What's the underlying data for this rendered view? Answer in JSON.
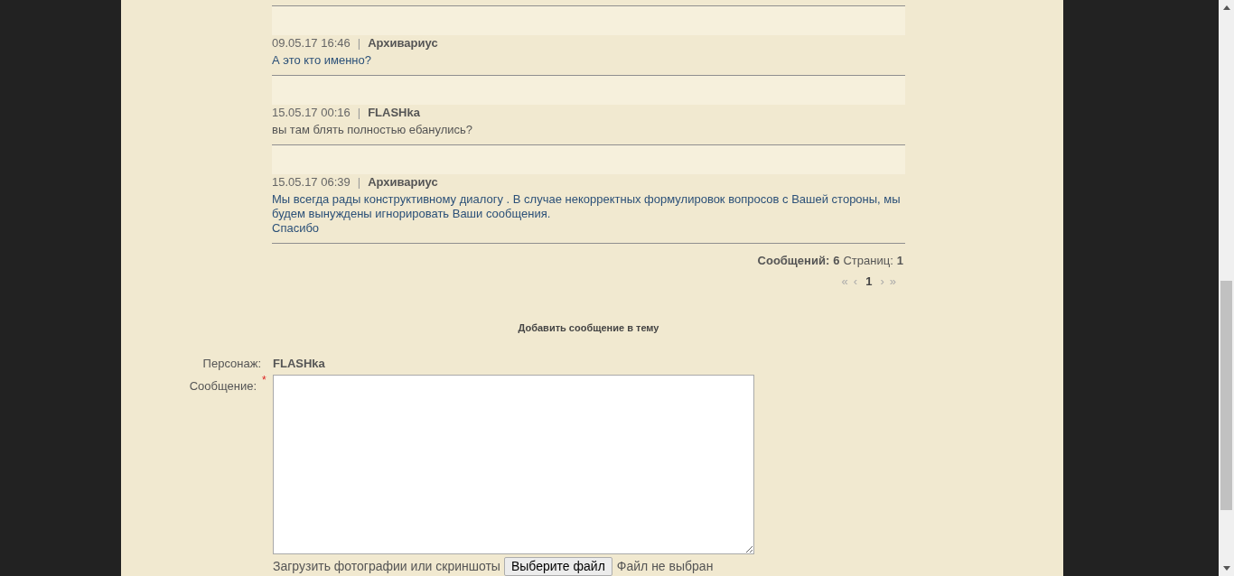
{
  "posts": [
    {
      "date": "09.05.17 16:46",
      "separator": "|",
      "author": "Архивариус",
      "kind": "staff",
      "body": [
        "А это кто именно?"
      ]
    },
    {
      "date": "15.05.17 00:16",
      "separator": "|",
      "author": "FLASHka",
      "kind": "user",
      "body": [
        "вы там блять полностью ебанулись?"
      ]
    },
    {
      "date": "15.05.17 06:39",
      "separator": "|",
      "author": "Архивариус",
      "kind": "staff",
      "body": [
        "Мы всегда рады конструктивному диалогу . В случае некорректных формулировок вопросов с Вашей стороны, мы будем вынуждены игнорировать Ваши сообщения.",
        "Спасибо"
      ]
    }
  ],
  "summary": {
    "messages_label": "Сообщений:",
    "messages": "6",
    "pages_label": "Страниц:",
    "pages": "1"
  },
  "pagination": [
    {
      "label": "«",
      "selected": false
    },
    {
      "label": "‹",
      "selected": false
    },
    {
      "label": "1",
      "selected": true
    },
    {
      "label": "›",
      "selected": false
    },
    {
      "label": "»",
      "selected": false
    }
  ],
  "form": {
    "title": "Добавить сообщение в тему",
    "character_label": "Персонаж:",
    "character": "FLASHka",
    "message_label": "Сообщение:",
    "required_mark": "*",
    "upload_label": "Загрузить фотографии или скриншоты",
    "file_button": "Выберите файл",
    "file_status": "Файл не выбран"
  }
}
